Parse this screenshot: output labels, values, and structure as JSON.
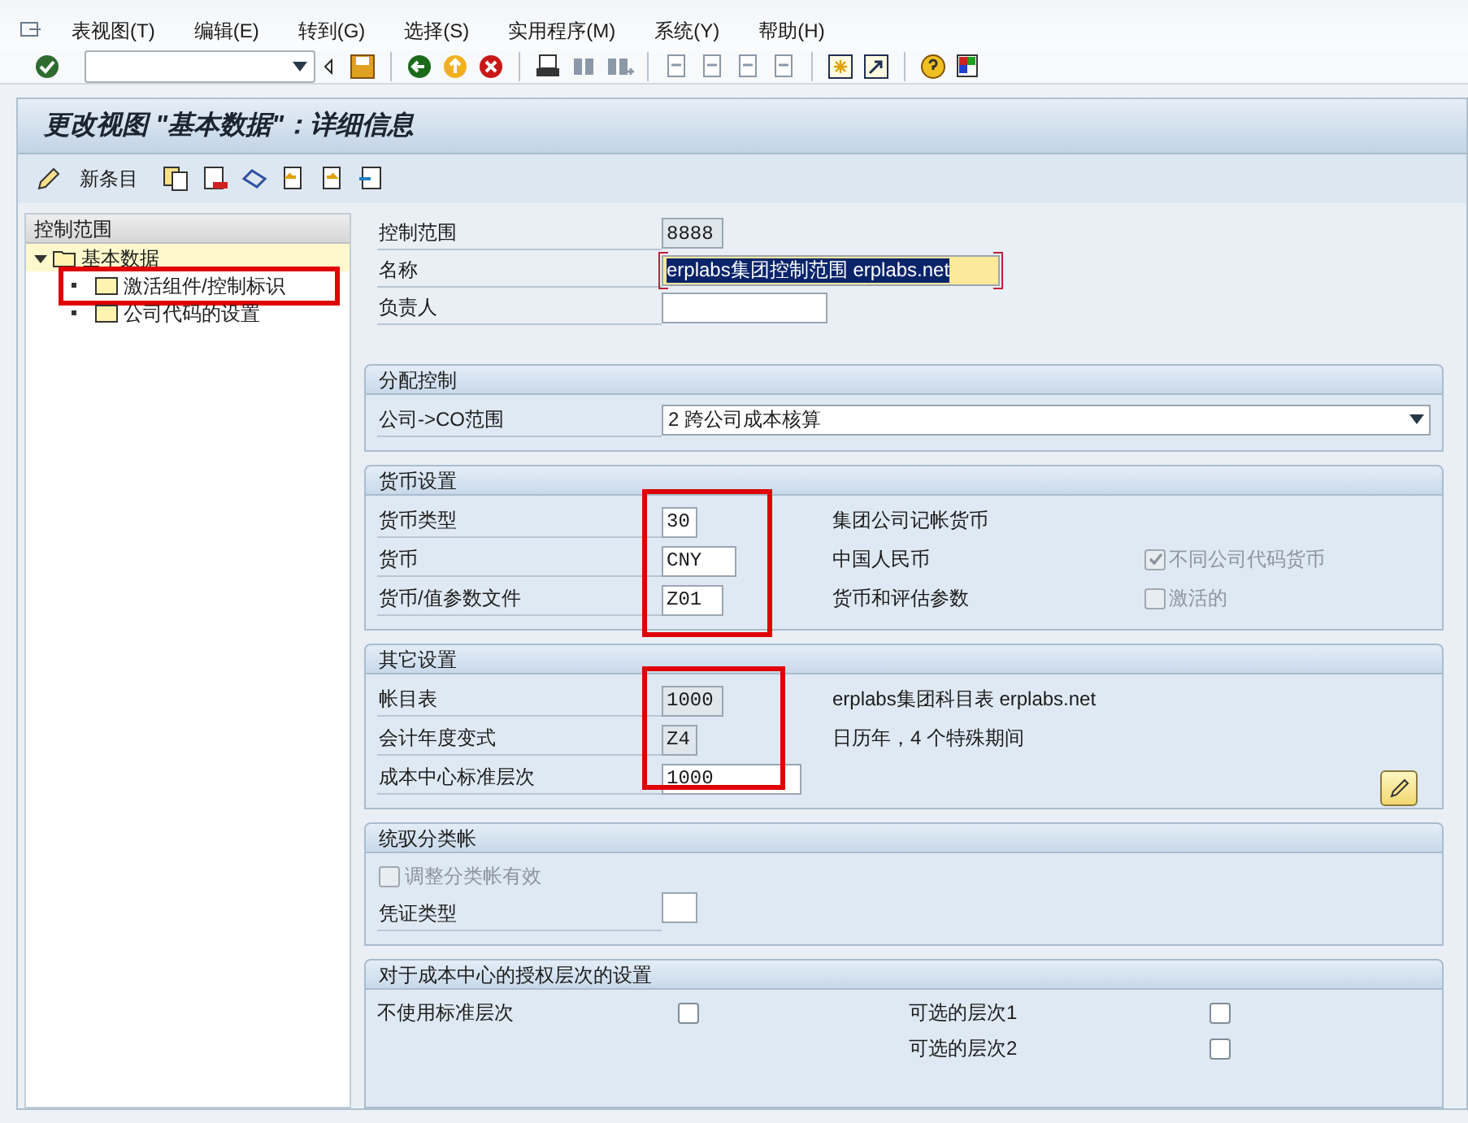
{
  "menu": [
    "表视图(T)",
    "编辑(E)",
    "转到(G)",
    "选择(S)",
    "实用程序(M)",
    "系统(Y)",
    "帮助(H)"
  ],
  "title": "更改视图 \"基本数据\"：详细信息",
  "app_toolbar": {
    "new_entry": "新条目"
  },
  "tree": {
    "header": "控制范围",
    "root": {
      "label": "基本数据",
      "expanded": true,
      "selected": true,
      "children": [
        {
          "label": "激活组件/控制标识",
          "annotated": true
        },
        {
          "label": "公司代码的设置",
          "annotated": false
        }
      ]
    }
  },
  "header_fields": [
    {
      "label": "控制范围",
      "value": "8888",
      "kind": "display"
    },
    {
      "label": "名称",
      "value": "erplabs集团控制范围 erplabs.net",
      "kind": "focused"
    },
    {
      "label": "负责人",
      "kind": "input"
    }
  ],
  "sections": [
    {
      "title": "分配控制",
      "annotated": false,
      "kind": "rows",
      "rows": [
        {
          "kind": "dropdown",
          "label": "公司->CO范围",
          "value": "2 跨公司成本核算"
        }
      ]
    },
    {
      "title": "货币设置",
      "annotated": true,
      "kind": "rows",
      "rows": [
        {
          "kind": "field",
          "label": "货币类型",
          "value": "30",
          "editable": true,
          "description": "集团公司记帐货币"
        },
        {
          "kind": "field",
          "label": "货币",
          "value": "CNY",
          "editable": true,
          "description": "中国人民币",
          "checkbox": {
            "label": "不同公司代码货币",
            "checked": true,
            "disabled": true
          }
        },
        {
          "kind": "field",
          "label": "货币/值参数文件",
          "value": "Z01",
          "editable": true,
          "description": "货币和评估参数",
          "checkbox": {
            "label": "激活的",
            "checked": false,
            "disabled": true
          }
        }
      ]
    },
    {
      "title": "其它设置",
      "annotated": true,
      "kind": "rows",
      "rows": [
        {
          "kind": "field",
          "label": "帐目表",
          "value": "1000",
          "editable": false,
          "description": "erplabs集团科目表 erplabs.net"
        },
        {
          "kind": "field",
          "label": "会计年度变式",
          "value": "Z4",
          "editable": false,
          "description": "日历年，4 个特殊期间"
        },
        {
          "kind": "field",
          "label": "成本中心标准层次",
          "value": "1000",
          "editable": true,
          "edit_button": true
        }
      ]
    },
    {
      "title": "统驭分类帐",
      "annotated": false,
      "kind": "rows",
      "rows": [
        {
          "kind": "checkbox",
          "label": "调整分类帐有效",
          "checked": false,
          "disabled": true
        },
        {
          "kind": "field",
          "label": "凭证类型",
          "editable": true
        }
      ]
    },
    {
      "title": "对于成本中心的授权层次的设置",
      "annotated": false,
      "kind": "columns",
      "columns": [
        [
          {
            "label": "不使用标准层次",
            "checked": false
          }
        ],
        [
          {
            "label": "可选的层次1",
            "checked": false
          },
          {
            "label": "可选的层次2",
            "checked": false
          }
        ]
      ]
    }
  ]
}
